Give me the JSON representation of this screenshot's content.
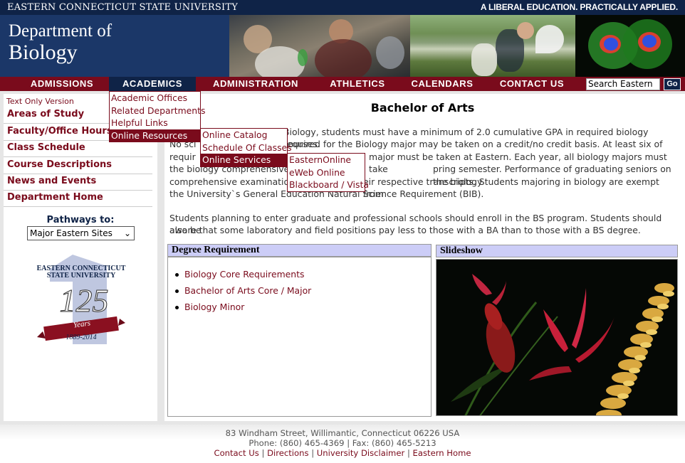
{
  "top_strip": {
    "university": "EASTERN CONNECTICUT STATE UNIVERSITY",
    "tagline": "A LIBERAL EDUCATION. PRACTICALLY APPLIED."
  },
  "banner": {
    "line1": "Department of",
    "line2": "Biology"
  },
  "nav": {
    "items": [
      "ADMISSIONS",
      "ACADEMICS",
      "ADMINISTRATION",
      "ATHLETICS",
      "CALENDARS",
      "CONTACT US"
    ],
    "active": "ACADEMICS",
    "search_value": "Search Eastern",
    "go_label": "Go"
  },
  "menus": {
    "academics": [
      "Academic Offices",
      "Related Departments",
      "Helpful Links",
      "Online Resources"
    ],
    "online_resources": [
      "Online Catalog",
      "Schedule Of Classes",
      "Online Services"
    ],
    "online_services": [
      "EasternOnline",
      "eWeb Online",
      "Blackboard / Vista"
    ]
  },
  "sidebar": {
    "text_only": "Text Only Version",
    "links": [
      "Areas of Study",
      "Faculty/Office Hours",
      "Class Schedule",
      "Course Descriptions",
      "News and Events",
      "Department Home"
    ],
    "pathways_label": "Pathways to:",
    "pathways_value": "Major Eastern Sites",
    "logo": {
      "line1": "EASTERN CONNECTICUT",
      "line2": "STATE UNIVERSITY",
      "number": "125",
      "word": "Years",
      "dates": "1889-2014"
    }
  },
  "main": {
    "title": "Bachelor of Arts",
    "para1_lines": [
      "",
      "No sci",
      "requir",
      "the biology comprehensive e",
      "comprehensive examination",
      "the University`s General Education Natural Science Requirement (BIB)."
    ],
    "para1_right": [
      "Biology, students must have a minimum of 2.0 cumulative GPA in required biology courses.",
      "required for the Biology major may be taken on a credit/no credit basis. At least six of the",
      "major must be taken at Eastern. Each year, all biology majors must take",
      "pring semester. Performance of graduating seniors on the biology",
      "eir respective transcripts. Students majoring in biology are exempt from"
    ],
    "para2_lines": [
      "Students planning to enter graduate and professional schools should enroll in the BS program. Students should also be",
      "aware that some laboratory and field positions pay less to those with a BA than to those with a BS degree."
    ],
    "degree_header": "Degree Requirement",
    "degree_links": [
      "Biology Core Requirements",
      "Bachelor of Arts Core / Major",
      "Biology Minor"
    ],
    "slideshow_header": "Slideshow"
  },
  "footer": {
    "address": "83 Windham Street, Willimantic, Connecticut 06226 USA",
    "phone": "Phone: (860) 465-4369 | Fax: (860) 465-5213",
    "links": [
      "Contact Us",
      "Directions",
      "University Disclaimer",
      "Eastern Home"
    ]
  }
}
